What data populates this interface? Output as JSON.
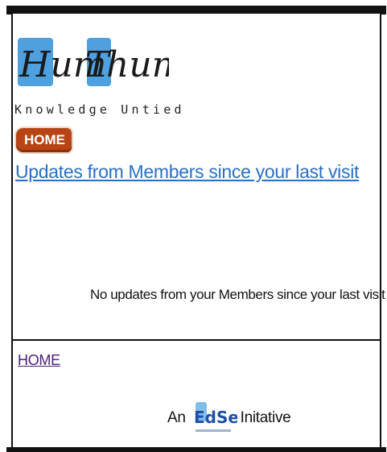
{
  "brand": {
    "logo_text": "Hum Thum",
    "tagline": "Knowledge Untied"
  },
  "nav": {
    "home_badge": "HOME"
  },
  "main": {
    "updates_link": "Updates from Members since your last visit",
    "no_updates_message": "No updates from your Members since your last visit"
  },
  "footer": {
    "home_link": "HOME",
    "initiative_prefix": "An",
    "initiative_logo": "EdServ",
    "initiative_suffix": "Initative"
  },
  "colors": {
    "link": "#2a6fc6",
    "visited_link": "#4b1d7a",
    "badge": "#b84416",
    "logo_blue": "#2f8fd8"
  }
}
